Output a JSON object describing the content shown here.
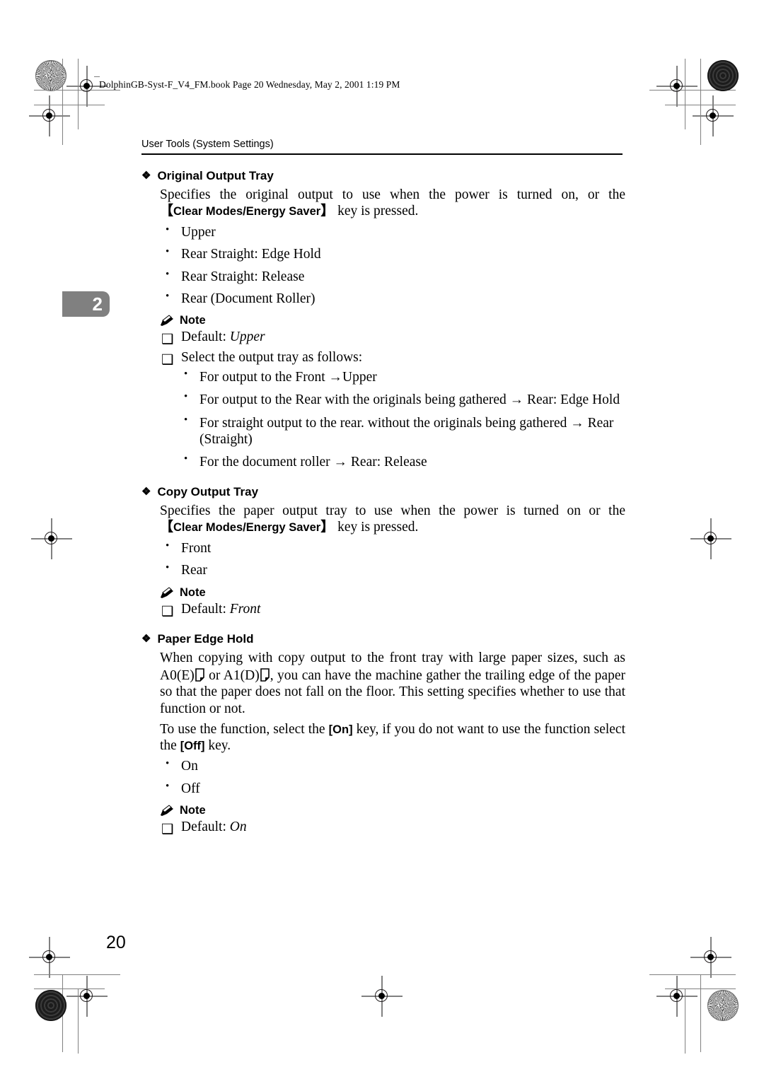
{
  "file_stamp": "DolphinGB-Syst-F_V4_FM.book  Page 20  Wednesday, May 2, 2001  1:19 PM",
  "running_head": "User Tools (System Settings)",
  "chapter_tab": "2",
  "page_number": "20",
  "icons": {
    "diamond": "❖",
    "note_pencil": "pencil-icon",
    "note_box": "❑",
    "bullet": "•",
    "arrow": "→",
    "bracket_open": "【",
    "bracket_close": "】"
  },
  "sections": [
    {
      "title": "Original Output Tray",
      "body_pre": "Specifies the original output to use when the power is turned on, or the ",
      "key_label": "Clear Modes/Energy Saver",
      "body_post": " key is pressed.",
      "options": [
        "Upper",
        "Rear Straight: Edge Hold",
        "Rear Straight: Release",
        "Rear (Document Roller)"
      ],
      "note": {
        "label": "Note",
        "items": [
          {
            "text": "Default: ",
            "emphasis": "Upper"
          },
          {
            "text": "Select the output tray as follows:",
            "emphasis": ""
          }
        ],
        "sub_items": [
          "For output to the Front →Upper",
          "For output to the Rear with the originals being gathered → Rear: Edge Hold",
          "For straight output to the rear. without the originals being gathered → Rear (Straight)",
          "For the document roller → Rear: Release"
        ]
      }
    },
    {
      "title": "Copy Output Tray",
      "body_pre": "Specifies the paper output tray to use when the power is turned on or the ",
      "key_label": "Clear Modes/Energy Saver",
      "body_post": " key is pressed.",
      "options": [
        "Front",
        "Rear"
      ],
      "note": {
        "label": "Note",
        "items": [
          {
            "text": "Default: ",
            "emphasis": "Front"
          }
        ],
        "sub_items": []
      }
    },
    {
      "title": "Paper Edge Hold",
      "para1_a": "When copying with copy output to the front tray with large paper sizes, such as A0(E)",
      "para1_b": " or A1(D)",
      "para1_c": ", you can have the machine gather the trailing edge of the paper so that the paper does not fall on the floor. This setting specifies whether to use that function or not.",
      "para2_a": "To use the function, select the ",
      "para2_key_on": "[On]",
      "para2_b": " key, if you do not want to use the function select the ",
      "para2_key_off": "[Off]",
      "para2_c": " key.",
      "options": [
        "On",
        "Off"
      ],
      "note": {
        "label": "Note",
        "items": [
          {
            "text": "Default: ",
            "emphasis": "On"
          }
        ],
        "sub_items": []
      }
    }
  ],
  "colors": {
    "chapter_tab_bg": "#808080",
    "chapter_tab_fg": "#ffffff",
    "rule": "#000000",
    "crop_mark": "#808080"
  }
}
